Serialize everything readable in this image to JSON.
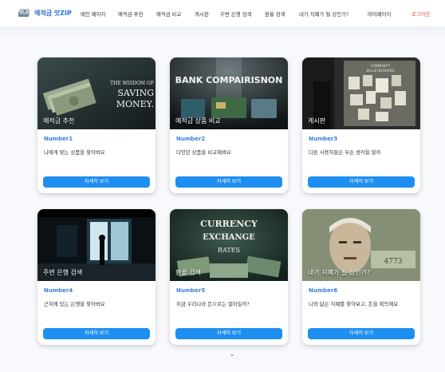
{
  "nav": {
    "logo_text": "예적금 맛ZIP",
    "items": [
      {
        "label": "메인 페이지"
      },
      {
        "label": "예적금 추천"
      },
      {
        "label": "예적금 비교"
      },
      {
        "label": "게시판"
      },
      {
        "label": "주변 은행 검색"
      },
      {
        "label": "환율 검색"
      },
      {
        "label": "내가 지폐가 될 상인가?"
      }
    ],
    "mypage": "마이페이지",
    "login": "로그아웃"
  },
  "cards": [
    {
      "image_caption": "예적금 추천",
      "image_text": "THE WISDOM OF SAVING MONEY",
      "number": "Number1",
      "description": "나에게 맞는 상품을 찾아봐요",
      "button": "자세히 보기"
    },
    {
      "image_caption": "예적금 상품 비교",
      "image_text": "BANK COMPAIRISNON",
      "number": "Number2",
      "description": "다양한 상품을 비교해봐요",
      "button": "자세히 보기"
    },
    {
      "image_caption": "게시판",
      "image_text": "COMMUNITY BULLETIN BOARD",
      "number": "Number3",
      "description": "다른 사용자들은 무슨 생각을 할까",
      "button": "자세히 보기"
    },
    {
      "image_caption": "주변 은행 검색",
      "image_text": "",
      "number": "Number4",
      "description": "근처에 있는 은행을 찾아봐요",
      "button": "자세히 보기"
    },
    {
      "image_caption": "환율 검색",
      "image_text": "CURRENCY EXCHANGE RATES",
      "number": "Number5",
      "description": "지금 우리나라 돈으로는 얼마일까?",
      "button": "자세히 보기"
    },
    {
      "image_caption": "내가 지폐가 될 상인가?",
      "image_text": "",
      "number": "Number6",
      "description": "나와 닮은 지폐를 찾아보고, 돈을 획득해요",
      "button": "자세히 보기"
    }
  ],
  "colors": {
    "accent": "#1e8ff0",
    "number_text": "#3a7fd9",
    "logo": "#2b6fd6",
    "logout": "#e04a3a"
  },
  "icons": {
    "logo": "money-stack-icon",
    "scroll": "chevron-down-icon"
  }
}
